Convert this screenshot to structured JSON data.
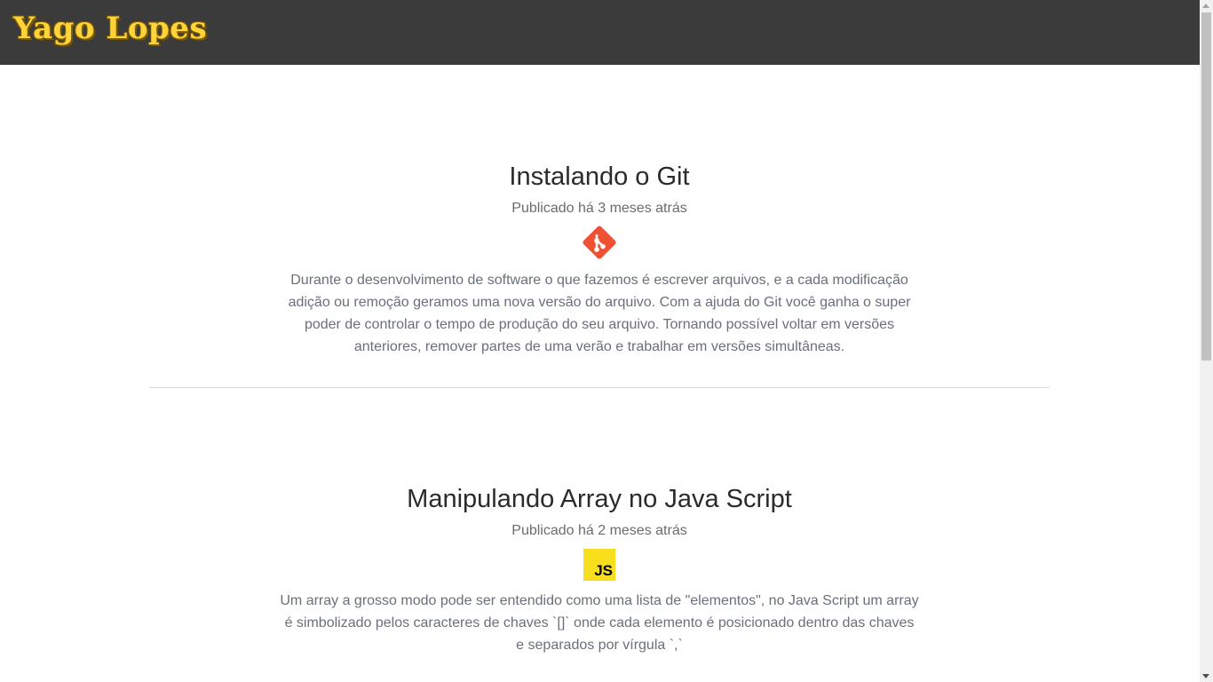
{
  "header": {
    "logo": "Yago Lopes"
  },
  "posts": [
    {
      "title": "Instalando o Git",
      "meta": "Publicado há 3 meses atrás",
      "icon": "git-icon",
      "text": "Durante o desenvolvimento de software o que fazemos é escrever arquivos, e a cada modificação adição ou remoção geramos uma nova versão do arquivo. Com a ajuda do Git você ganha o super poder de controlar o tempo de produção do seu arquivo. Tornando possível voltar em versões anteriores, remover partes de uma verão e trabalhar em versões simultâneas."
    },
    {
      "title": "Manipulando Array no Java Script",
      "meta": "Publicado há 2 meses atrás",
      "icon": "javascript-icon",
      "icon_text": "JS",
      "text": "Um array a grosso modo pode ser entendido como uma lista de \"elementos\", no Java Script um array é simbolizado pelos caracteres de chaves `[]` onde cada elemento é posicionado dentro das chaves e separados por vírgula `,`"
    }
  ],
  "colors": {
    "header_bg": "#3c3b3b",
    "logo": "#ffd43b",
    "git": "#f05133",
    "js": "#f7df1e"
  }
}
